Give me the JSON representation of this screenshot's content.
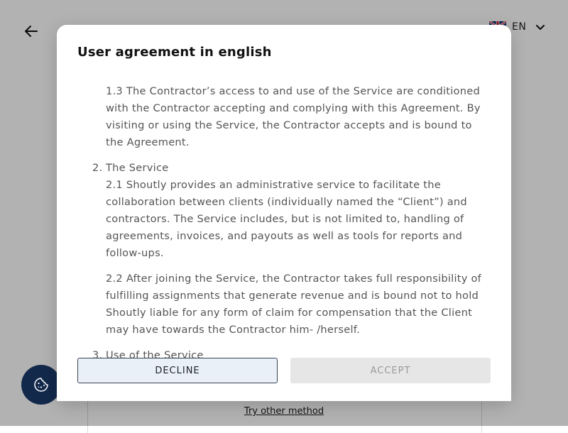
{
  "page": {
    "language_code": "EN",
    "try_other_method": "Try other method"
  },
  "modal": {
    "title": "User agreement in english",
    "section_1_3": "1.3 The Contractor’s access to and use of the Service are conditioned with the Contractor accepting and complying with this Agreement. By visiting or using the Service, the Contractor accepts and is bound to the Agreement.",
    "section_2": {
      "number": "2.",
      "heading": "The Service",
      "p1": "2.1 Shoutly provides an administrative service to facilitate the collaboration between clients (individually named the “Client”) and contractors. The Service includes, but is not limited to, handling of agreements, invoices, and payouts as well as tools for reports and follow-ups.",
      "p2": "2.2 After joining the Service, the Contractor takes full responsibility of fulfilling assignments that generate revenue and is bound not to hold Shoutly liable for any form of claim for compensation that the Client may have towards the Contractor him- /herself."
    },
    "section_3": {
      "number": "3.",
      "heading": "Use of the Service"
    },
    "decline_label": "DECLINE",
    "accept_label": "ACCEPT"
  },
  "icons": {
    "back": "arrow-left-icon",
    "flag": "uk-flag-icon",
    "chevron": "chevron-down-icon",
    "cookie": "cookie-icon"
  },
  "colors": {
    "cookie_button": "#13294b",
    "decline_bg": "#eaf0f8",
    "accept_bg_disabled": "#e6e6e6"
  }
}
